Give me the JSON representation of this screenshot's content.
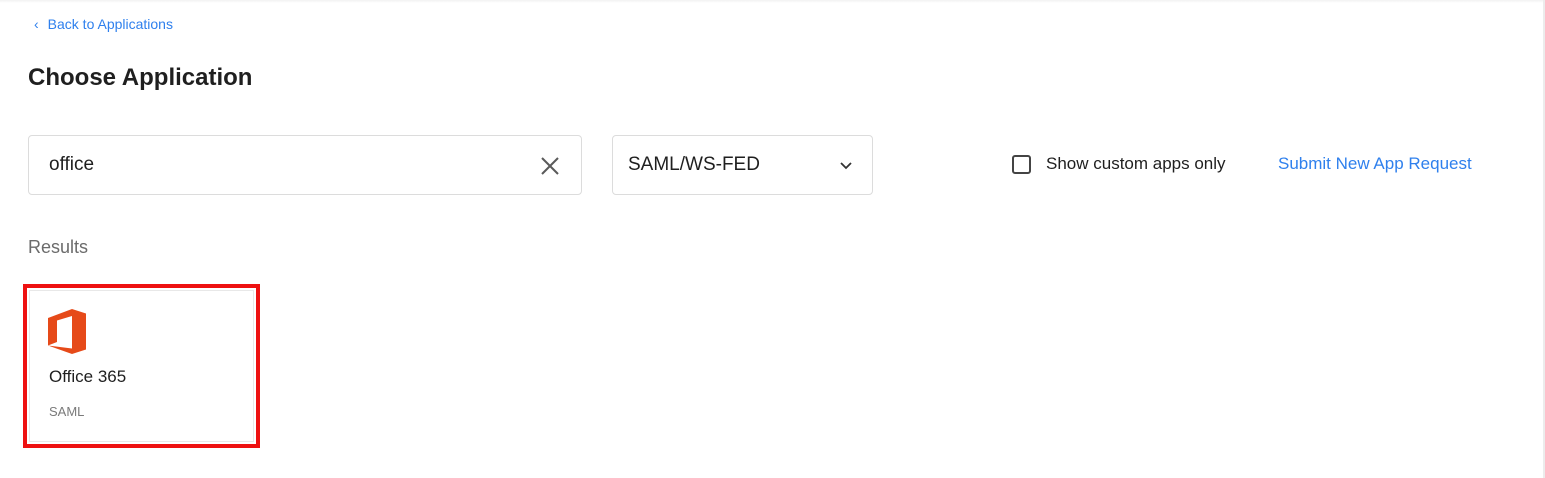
{
  "nav": {
    "back_label": "Back to Applications",
    "back_chevron": "‹"
  },
  "page": {
    "title": "Choose Application"
  },
  "search": {
    "value": "office",
    "clear_icon": "close-icon"
  },
  "filter": {
    "selected": "SAML/WS-FED",
    "icon": "chevron-down-icon"
  },
  "custom_apps": {
    "label": "Show custom apps only",
    "checked": false
  },
  "submit_link": {
    "label": "Submit New App Request"
  },
  "results": {
    "label": "Results",
    "items": [
      {
        "name": "Office 365",
        "type": "SAML",
        "icon": "office-icon",
        "highlighted": true
      }
    ]
  },
  "colors": {
    "link": "#2f80ed",
    "highlight": "#ee1111",
    "office_brand": "#e64a19"
  }
}
